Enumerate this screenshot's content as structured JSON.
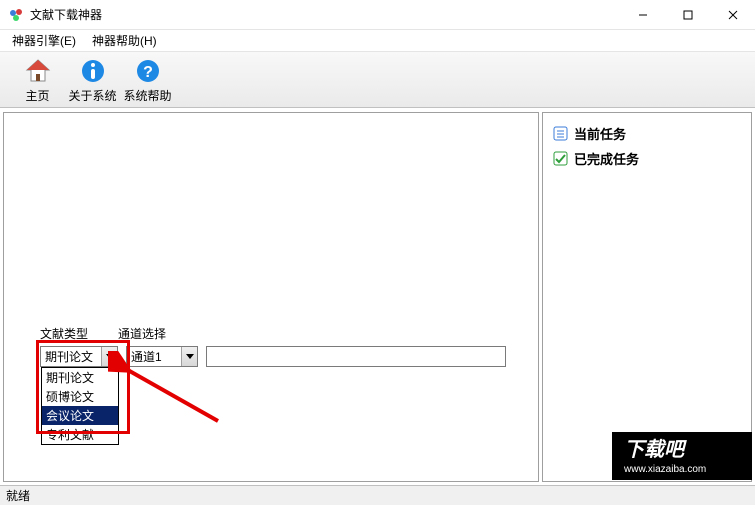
{
  "title": "文献下载神器",
  "menubar": {
    "engine": "神器引擎(E)",
    "help": "神器帮助(H)"
  },
  "toolbar": {
    "home": "主页",
    "about": "关于系统",
    "syshelp": "系统帮助"
  },
  "form": {
    "type_label": "文献类型",
    "channel_label": "通道选择",
    "type_selected": "期刊论文",
    "channel_selected": "通道1",
    "type_options": [
      "期刊论文",
      "硕博论文",
      "会议论文",
      "专利文献"
    ],
    "input_value": ""
  },
  "side": {
    "current": "当前任务",
    "completed": "已完成任务"
  },
  "status": "就绪",
  "watermark": {
    "line1": "下载吧",
    "line2": "www.xiazaiba.com"
  },
  "colors": {
    "highlight": "#e30000",
    "selection": "#0a246a"
  }
}
